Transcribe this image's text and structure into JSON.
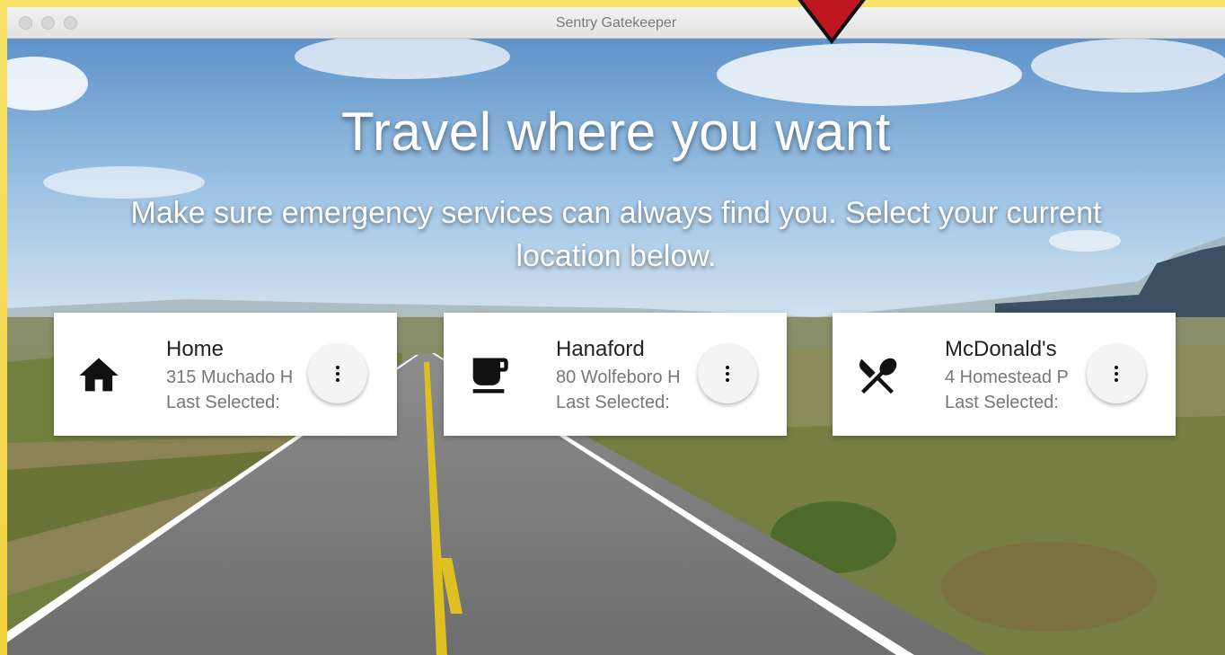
{
  "window": {
    "title": "Sentry Gatekeeper"
  },
  "hero": {
    "title": "Travel where you want",
    "subtitle": "Make sure emergency services can always find you. Select your current location below."
  },
  "locations": [
    {
      "name": "Home",
      "address": "315 Muchado H",
      "last_selected": "Last Selected:",
      "icon": "home-icon"
    },
    {
      "name": "Hanaford",
      "address": "80 Wolfeboro H",
      "last_selected": "Last Selected:",
      "icon": "coffee-cup-icon"
    },
    {
      "name": "McDonald's",
      "address": "4 Homestead P",
      "last_selected": "Last Selected:",
      "icon": "restaurant-icon"
    }
  ],
  "colors": {
    "frame": "#f2d13e",
    "marker": "#c0161f",
    "card": "#ffffff"
  }
}
